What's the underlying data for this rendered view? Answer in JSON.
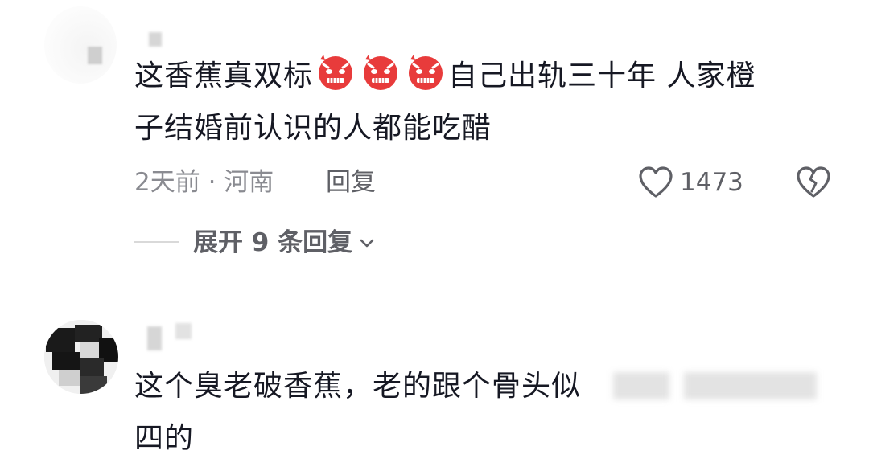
{
  "comments": [
    {
      "line1_a": "这香蕉真双标",
      "line1_b": "自己出轨三十年  人家橙",
      "line2": "子结婚前认识的人都能吃醋",
      "emoji_name": "angry-face-emoji",
      "time_location": "2天前 · 河南",
      "reply_label": "回复",
      "like_count": "1473",
      "expand_label": "展开 9 条回复"
    },
    {
      "line1": "这个臭老破香蕉，老的跟个骨头似",
      "line2": "四的"
    }
  ],
  "colors": {
    "text_primary": "#161823",
    "text_secondary": "#8a8b91",
    "emoji_red": "#e83b3b"
  }
}
